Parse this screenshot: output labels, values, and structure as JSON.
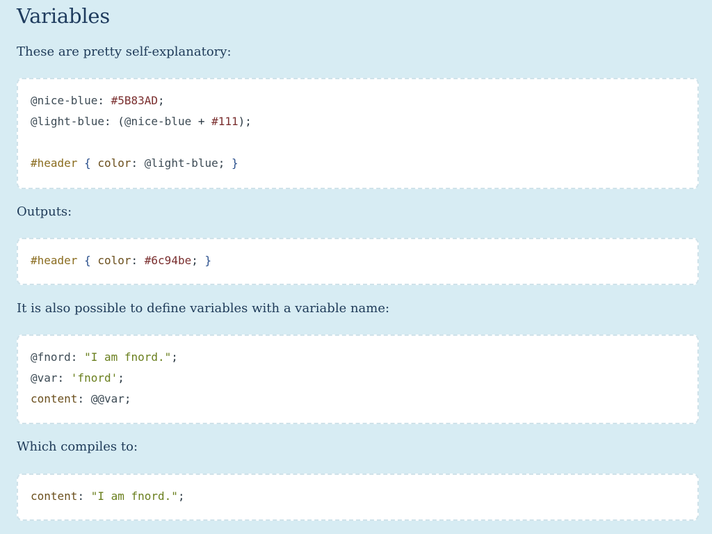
{
  "page": {
    "title": "Variables"
  },
  "sections": [
    {
      "text": "These are pretty self-explanatory:",
      "code": [
        [
          {
            "t": "@nice-blue",
            "c": "var"
          },
          {
            "t": ": ",
            "c": "punc"
          },
          {
            "t": "#5B83AD",
            "c": "hex"
          },
          {
            "t": ";",
            "c": "punc"
          }
        ],
        [
          {
            "t": "@light-blue",
            "c": "var"
          },
          {
            "t": ": (",
            "c": "punc"
          },
          {
            "t": "@nice-blue",
            "c": "var"
          },
          {
            "t": " + ",
            "c": "op"
          },
          {
            "t": "#111",
            "c": "hex"
          },
          {
            "t": ");",
            "c": "punc"
          }
        ],
        [],
        [
          {
            "t": "#header",
            "c": "sel"
          },
          {
            "t": " { ",
            "c": "brace"
          },
          {
            "t": "color",
            "c": "prop"
          },
          {
            "t": ": ",
            "c": "punc"
          },
          {
            "t": "@light-blue",
            "c": "var"
          },
          {
            "t": "; ",
            "c": "punc"
          },
          {
            "t": "}",
            "c": "brace"
          }
        ]
      ]
    },
    {
      "text": "Outputs:",
      "code": [
        [
          {
            "t": "#header",
            "c": "sel"
          },
          {
            "t": " { ",
            "c": "brace"
          },
          {
            "t": "color",
            "c": "prop"
          },
          {
            "t": ": ",
            "c": "punc"
          },
          {
            "t": "#6c94be",
            "c": "hex"
          },
          {
            "t": "; ",
            "c": "punc"
          },
          {
            "t": "}",
            "c": "brace"
          }
        ]
      ]
    },
    {
      "text": "It is also possible to define variables with a variable name:",
      "code": [
        [
          {
            "t": "@fnord",
            "c": "var"
          },
          {
            "t": ": ",
            "c": "punc"
          },
          {
            "t": "\"I am fnord.\"",
            "c": "str"
          },
          {
            "t": ";",
            "c": "punc"
          }
        ],
        [
          {
            "t": "@var",
            "c": "var"
          },
          {
            "t": ": ",
            "c": "punc"
          },
          {
            "t": "'fnord'",
            "c": "str"
          },
          {
            "t": ";",
            "c": "punc"
          }
        ],
        [
          {
            "t": "content",
            "c": "prop"
          },
          {
            "t": ": ",
            "c": "punc"
          },
          {
            "t": "@@var",
            "c": "var"
          },
          {
            "t": ";",
            "c": "punc"
          }
        ]
      ]
    },
    {
      "text": "Which compiles to:",
      "code": [
        [
          {
            "t": "content",
            "c": "prop"
          },
          {
            "t": ": ",
            "c": "punc"
          },
          {
            "t": "\"I am fnord.\"",
            "c": "str"
          },
          {
            "t": ";",
            "c": "punc"
          }
        ]
      ]
    }
  ],
  "colors": {
    "background": "#d7ecf3",
    "code_background": "#ffffff",
    "heading": "#1f3c5e",
    "text": "#1e3a58",
    "hex_literal": "#7a2e2e",
    "selector": "#8a6c1f",
    "property": "#6b4f1d",
    "string": "#6a7f1e",
    "brace": "#2a4f8c"
  }
}
